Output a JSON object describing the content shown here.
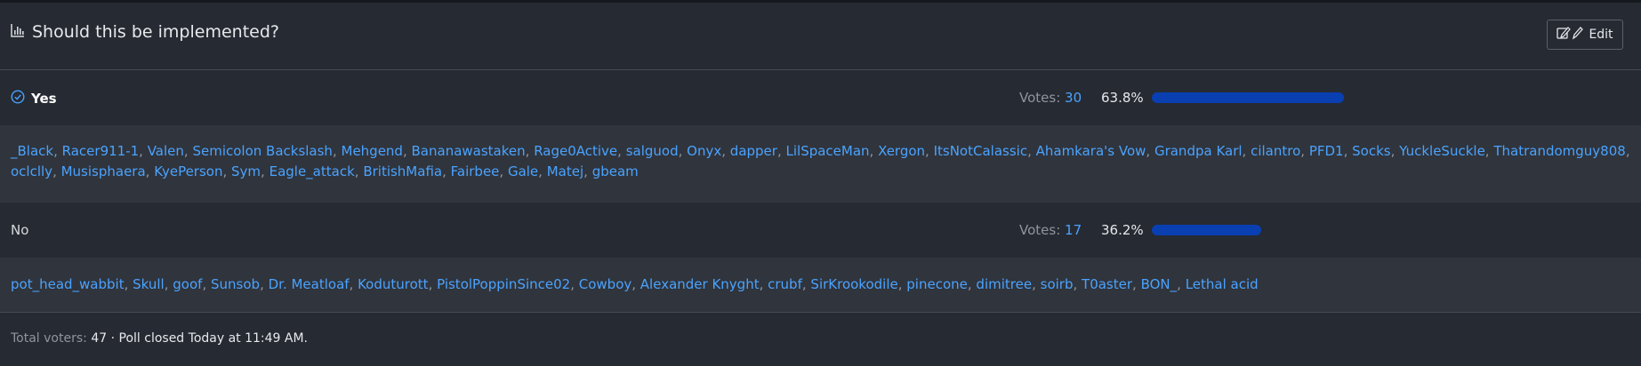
{
  "poll": {
    "title": "Should this be implemented?",
    "edit_label": "Edit"
  },
  "choices": [
    {
      "label": "Yes",
      "voted": true,
      "votes_label": "Votes:",
      "votes": "30",
      "percent": "63.8%",
      "fraction": 0.638,
      "voters": [
        "_Black",
        "Racer911-1",
        "Valen",
        "Semicolon Backslash",
        "Mehgend",
        "Bananawastaken",
        "Rage0Active",
        "salguod",
        "Onyx",
        "dapper",
        "LilSpaceMan",
        "Xergon",
        "ItsNotCalassic",
        "Ahamkara's Vow",
        "Grandpa Karl",
        "cilantro",
        "PFD1",
        "Socks",
        "YuckleSuckle",
        "Thatrandomguy808",
        "oclclly",
        "Musisphaera",
        "KyePerson",
        "Sym",
        "Eagle_attack",
        "BritishMafia",
        "Fairbee",
        "Gale",
        "Matej",
        "gbeam"
      ]
    },
    {
      "label": "No",
      "voted": false,
      "votes_label": "Votes:",
      "votes": "17",
      "percent": "36.2%",
      "fraction": 0.362,
      "voters": [
        "pot_head_wabbit",
        "Skull",
        "goof",
        "Sunsob",
        "Dr. Meatloaf",
        "Koduturott",
        "PistolPoppinSince02",
        "Cowboy",
        "Alexander Knyght",
        "crubf",
        "SirKrookodile",
        "pinecone",
        "dimitree",
        "soirb",
        "T0aster",
        "BON_",
        "Lethal acid"
      ]
    }
  ],
  "footer": {
    "total_label": "Total voters:",
    "total": "47",
    "closed_text": "· Poll closed Today at 11:49 AM."
  },
  "colors": {
    "bar": "#0a3fb2",
    "link": "#4aa3ff"
  },
  "icons": {
    "title": "bar-chart-icon",
    "edit": "edit-pencil-icon",
    "voted": "check-circle-icon"
  }
}
